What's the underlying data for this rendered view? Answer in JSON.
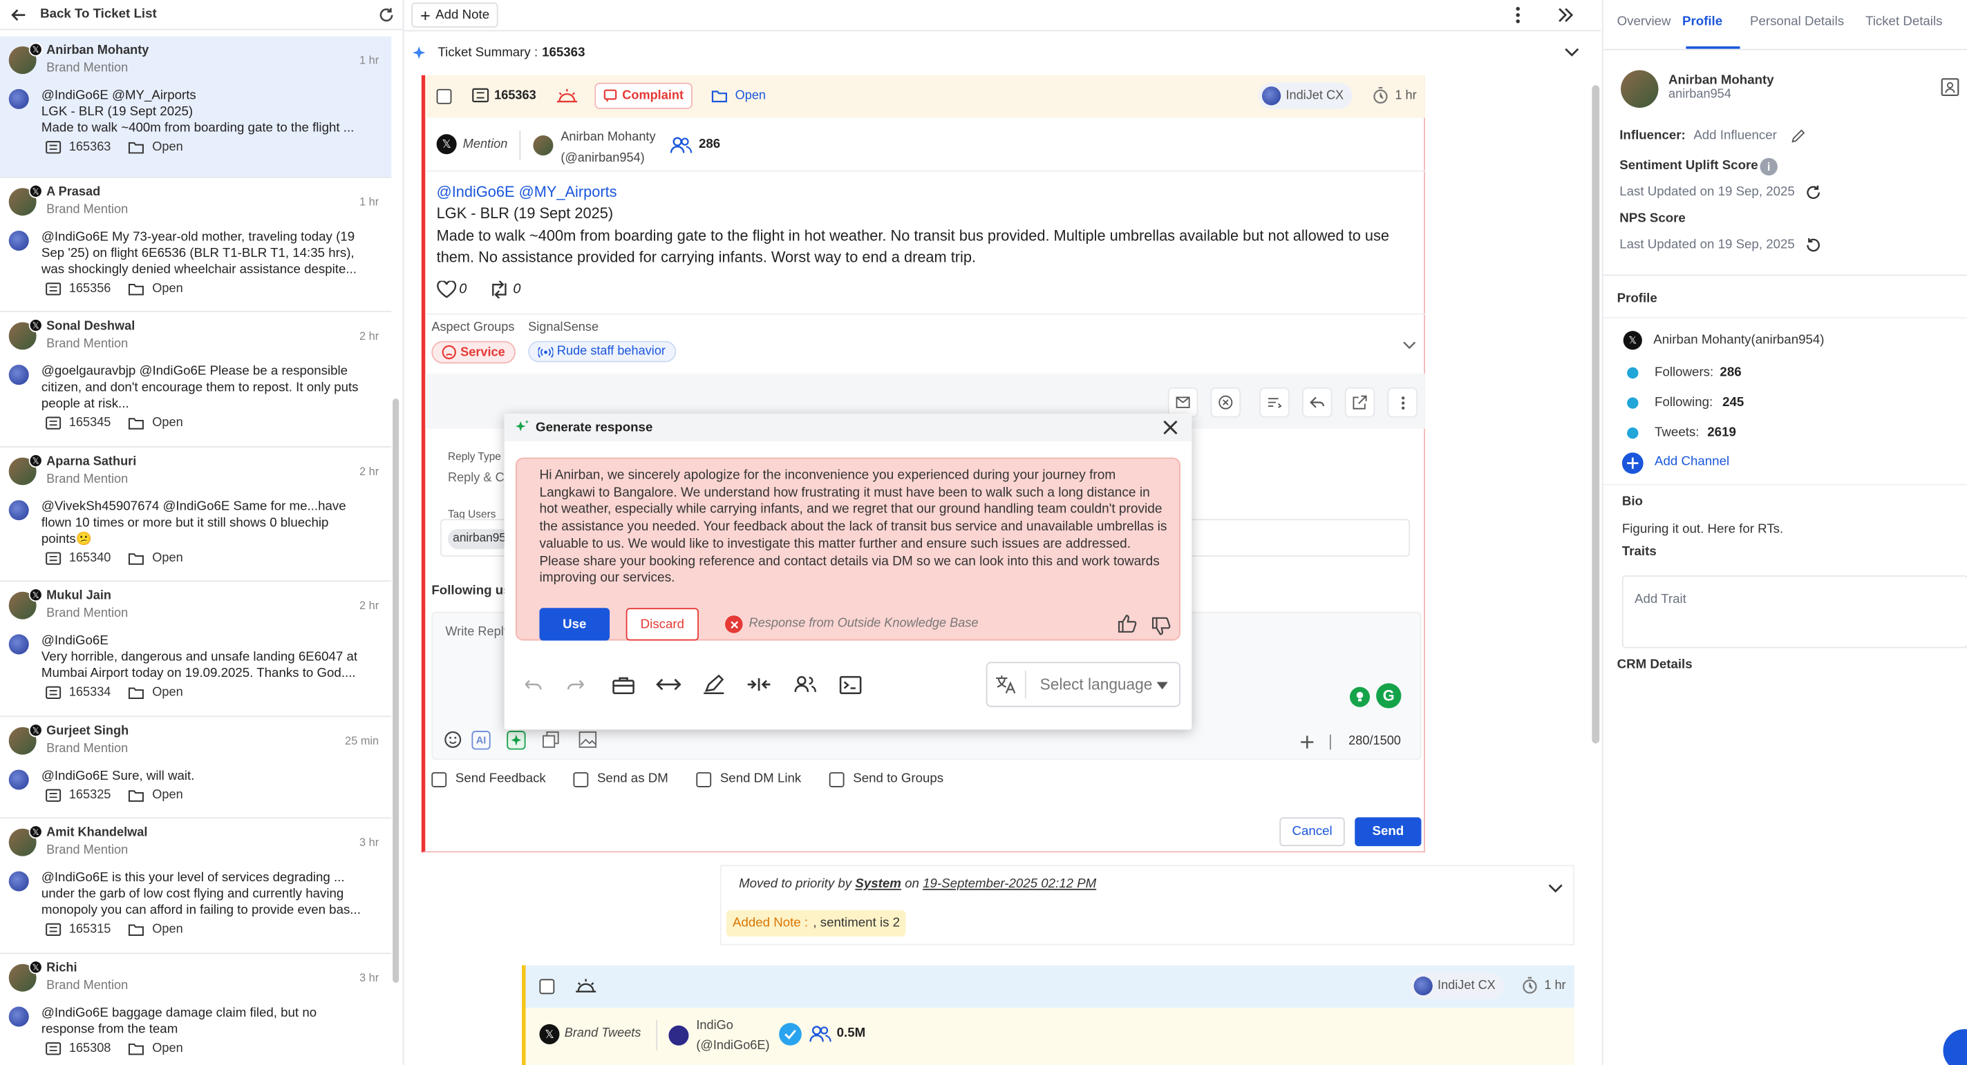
{
  "left": {
    "back_label": "Back To Ticket List",
    "tickets": [
      {
        "name": "Anirban Mohanty",
        "sub": "Brand Mention",
        "time": "1 hr",
        "lines": [
          "@IndiGo6E @MY_Airports",
          "LGK - BLR (19 Sept 2025)",
          "Made to walk ~400m from boarding gate to the flight ..."
        ],
        "id": "165363",
        "status": "Open"
      },
      {
        "name": "A Prasad",
        "sub": "Brand Mention",
        "time": "1 hr",
        "lines": [
          "@IndiGo6E My 73-year-old mother, traveling today (19",
          "Sep '25) on flight 6E6536 (BLR T1-BLR T1, 14:35 hrs),",
          "was shockingly denied wheelchair assistance despite..."
        ],
        "id": "165356",
        "status": "Open"
      },
      {
        "name": "Sonal Deshwal",
        "sub": "Brand Mention",
        "time": "2 hr",
        "lines": [
          "@goelgauravbjp @IndiGo6E Please be a responsible",
          "citizen, and don't encourage them to repost. It only puts",
          "people at risk..."
        ],
        "id": "165345",
        "status": "Open"
      },
      {
        "name": "Aparna Sathuri",
        "sub": "Brand Mention",
        "time": "2 hr",
        "lines": [
          "@VivekSh45907674 @IndiGo6E Same for me...have",
          "flown 10 times or more but it still shows 0 bluechip",
          "points😕"
        ],
        "id": "165340",
        "status": "Open"
      },
      {
        "name": "Mukul Jain",
        "sub": "Brand Mention",
        "time": "2 hr",
        "lines": [
          "@IndiGo6E",
          "Very horrible, dangerous and unsafe landing 6E6047 at",
          "Mumbai Airport today on 19.09.2025. Thanks to God...."
        ],
        "id": "165334",
        "status": "Open"
      },
      {
        "name": "Gurjeet Singh",
        "sub": "Brand Mention",
        "time": "25 min",
        "lines": [
          "@IndiGo6E Sure, will wait."
        ],
        "id": "165325",
        "status": "Open"
      },
      {
        "name": "Amit Khandelwal",
        "sub": "Brand Mention",
        "time": "3 hr",
        "lines": [
          "@IndiGo6E is this your level of services degrading ...",
          "under the garb of low cost flying and currently having",
          "monopoly you can afford in failing to provide even bas..."
        ],
        "id": "165315",
        "status": "Open"
      },
      {
        "name": "Richi",
        "sub": "Brand Mention",
        "time": "3 hr",
        "lines": [
          "@IndiGo6E baggage damage claim filed, but no",
          "response from the team"
        ],
        "id": "165308",
        "status": "Open"
      }
    ]
  },
  "topbar": {
    "add_note": "Add Note"
  },
  "summary": {
    "label": "Ticket Summary :",
    "id": "165363"
  },
  "ticket": {
    "id": "165363",
    "type": "Complaint",
    "status": "Open",
    "account": "IndiJet CX",
    "age": "1 hr",
    "channel": "Mention",
    "author_name": "Anirban Mohanty",
    "author_handle": "(@anirban954)",
    "followers": "286",
    "post_line1": "@IndiGo6E @MY_Airports",
    "post_line2": "LGK - BLR (19 Sept 2025)",
    "post_body": "Made to walk ~400m from boarding gate to the flight in hot weather. No transit bus provided. Multiple umbrellas available but not allowed to use them. No assistance provided for carrying infants. Worst way to end a dream trip.",
    "likes": "0",
    "retweets": "0",
    "aspect_label": "Aspect Groups",
    "signal_label": "SignalSense",
    "aspect_tag": "Service",
    "signal_tag": "Rude staff behavior"
  },
  "reply": {
    "reply_type_label": "Reply Type",
    "reply_type_value": "Reply & Cl",
    "tag_users_label": "Tag Users",
    "tag_user": "anirban95",
    "following_label": "Following use",
    "placeholder": "Write Reply",
    "counter": "280/1500",
    "send_feedback": "Send Feedback",
    "send_dm": "Send as DM",
    "send_dm_link": "Send DM Link",
    "send_groups": "Send to Groups",
    "cancel": "Cancel",
    "send": "Send"
  },
  "modal": {
    "title": "Generate response",
    "response": "Hi Anirban, we sincerely apologize for the inconvenience you experienced during your journey from Langkawi to Bangalore. We understand how frustrating it must have been to walk such a long distance in hot weather, especially while carrying infants, and we regret that our ground handling team couldn't provide the assistance you needed. Your feedback about the lack of transit bus service and unavailable umbrellas is valuable to us. We would like to investigate this matter further and ensure such issues are addressed. Please share your booking reference and contact details via DM so we can look into this and work towards improving our services.",
    "use": "Use",
    "discard": "Discard",
    "kb_note": "Response from Outside Knowledge Base",
    "language_placeholder": "Select language"
  },
  "activity": {
    "moved_prefix": "Moved to priority by",
    "moved_by": "System",
    "on": "on",
    "date": "19-September-2025 02:12 PM",
    "note_label": "Added Note :",
    "note_text": ", sentiment is 2"
  },
  "ticket2": {
    "account": "IndiJet CX",
    "age": "1 hr",
    "channel": "Brand Tweets",
    "author_name": "IndiGo",
    "author_handle": "(@IndiGo6E)",
    "followers": "0.5M"
  },
  "right": {
    "tabs": [
      "Overview",
      "Profile",
      "Personal Details",
      "Ticket Details"
    ],
    "name": "Anirban Mohanty",
    "handle": "anirban954",
    "influencer_label": "Influencer:",
    "influencer_value": "Add Influencer",
    "sentiment_label": "Sentiment Uplift Score",
    "updated1": "Last Updated on 19 Sep, 2025",
    "nps_label": "NPS Score",
    "updated2": "Last Updated on 19 Sep, 2025",
    "profile_heading": "Profile",
    "profile_account": "Anirban Mohanty(anirban954)",
    "followers_label": "Followers:",
    "followers": "286",
    "following_label": "Following:",
    "following": "245",
    "tweets_label": "Tweets:",
    "tweets": "2619",
    "add_channel": "Add Channel",
    "bio_heading": "Bio",
    "bio": "Figuring it out. Here for RTs.",
    "traits_heading": "Traits",
    "add_trait": "Add Trait",
    "crm_heading": "CRM Details"
  },
  "colors": {
    "accent": "#1a56db",
    "danger": "#e53935",
    "response_bg": "#fbd5d2"
  }
}
